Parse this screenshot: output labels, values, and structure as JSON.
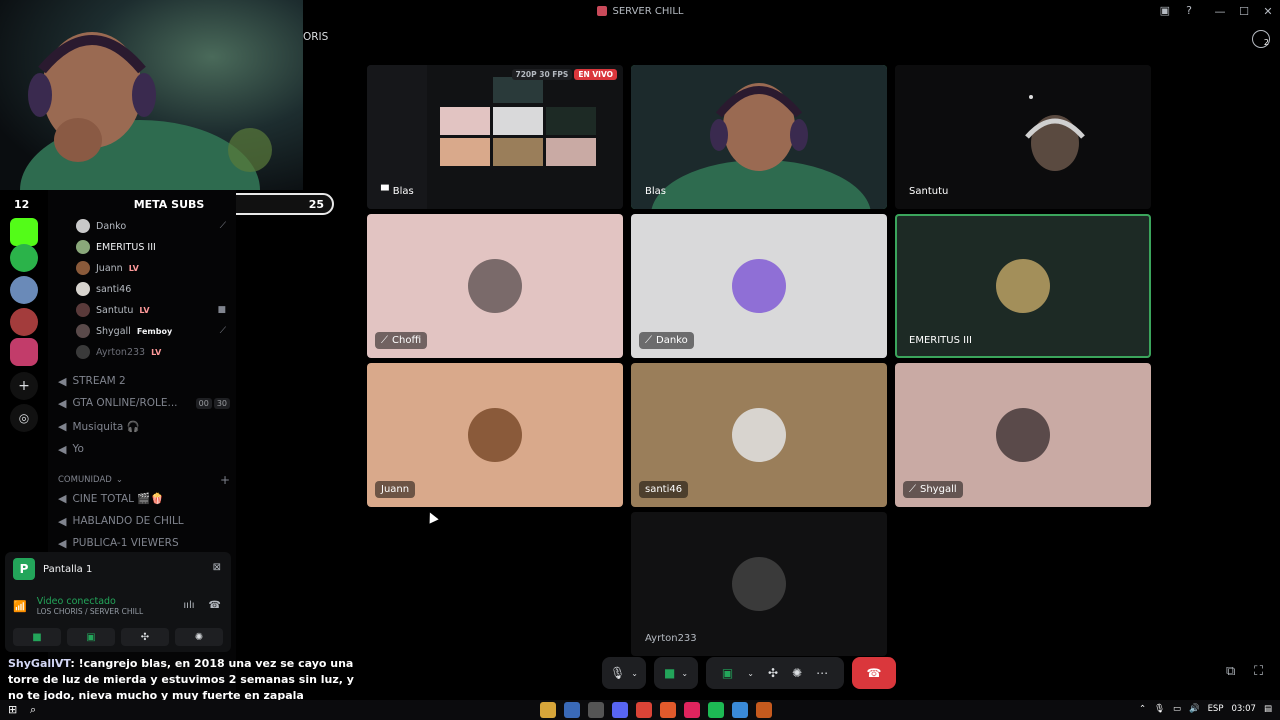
{
  "window": {
    "title": "SERVER CHILL"
  },
  "server_partial_name": "ORIS",
  "overlay": {
    "meta_left": "12",
    "meta_label": "META SUBS",
    "meta_right": "25",
    "progress": 0.48
  },
  "voice_users": [
    {
      "name": "Danko",
      "badge": "",
      "right_icon": "mute-icon"
    },
    {
      "name": "EMERITUS III",
      "badge": "",
      "right_icon": ""
    },
    {
      "name": "Juann",
      "badge": "LV",
      "right_icon": ""
    },
    {
      "name": "santi46",
      "badge": "",
      "right_icon": ""
    },
    {
      "name": "Santutu",
      "badge": "LV",
      "right_icon": "camera-icon"
    },
    {
      "name": "Shygall",
      "badge": "Femboy",
      "right_icon": "mute-icon"
    },
    {
      "name": "Ayrton233",
      "badge": "LV",
      "right_icon": ""
    }
  ],
  "channels_top": [
    {
      "name": "STREAM 2"
    },
    {
      "name": "GTA ONLINE/ROLE...",
      "count_a": "00",
      "count_b": "30"
    },
    {
      "name": "Musiquita 🎧"
    },
    {
      "name": "Yo"
    }
  ],
  "category": {
    "name": "COMUNIDAD"
  },
  "channels_bottom": [
    {
      "name": "CINE TOTAL 🎬🍿"
    },
    {
      "name": "HABLANDO DE CHILL"
    },
    {
      "name": "PUBLICA-1 VIEWERS"
    }
  ],
  "panel": {
    "avatar_letter": "P",
    "title": "Pantalla 1",
    "status": "Video conectado",
    "location": "LOS CHORIS / SERVER CHILL"
  },
  "stream_badges": {
    "quality": "720P 30 FPS",
    "live": "EN VIVO"
  },
  "tiles": [
    {
      "name": "Blas",
      "kind": "stream",
      "icon": "screen-share-icon"
    },
    {
      "name": "Blas",
      "kind": "camera",
      "speaking": true
    },
    {
      "name": "Santutu",
      "kind": "camera"
    },
    {
      "name": "Choffi",
      "kind": "avatar",
      "bg": "#e2c4c2",
      "avatar_color": "#7a6a6a",
      "icon": "deafened-icon"
    },
    {
      "name": "Danko",
      "kind": "avatar",
      "bg": "#d9d9da",
      "avatar_color": "#8f6fd6",
      "icon": "mute-icon"
    },
    {
      "name": "EMERITUS III",
      "kind": "avatar",
      "bg": "#1d2a25",
      "avatar_color": "#a38f5a",
      "speaking": true
    },
    {
      "name": "Juann",
      "kind": "avatar",
      "bg": "#d9a98b",
      "avatar_color": "#8a5a3a"
    },
    {
      "name": "santi46",
      "kind": "avatar",
      "bg": "#9a7e5a",
      "avatar_color": "#d8d4cf"
    },
    {
      "name": "Shygall",
      "kind": "avatar",
      "bg": "#c9aaa4",
      "avatar_color": "#5a4a4a",
      "icon": "mute-icon"
    },
    {
      "name": "Ayrton233",
      "kind": "avatar",
      "bg": "#111112",
      "avatar_color": "#3a3a3a"
    }
  ],
  "chat": {
    "user": "ShyGallVT",
    "message": ": !cangrejo blas, en 2018 una vez se cayo una torre de luz de mierda y estuvimos 2 semanas sin luz, y no te jodo, nieva mucho y muy fuerte en zapala"
  },
  "taskbar": {
    "lang": "ESP",
    "time": "03:07"
  },
  "colors": {
    "accent_green": "#23a55a",
    "end_call_red": "#da373c",
    "speaking_border": "#3ba55c"
  }
}
